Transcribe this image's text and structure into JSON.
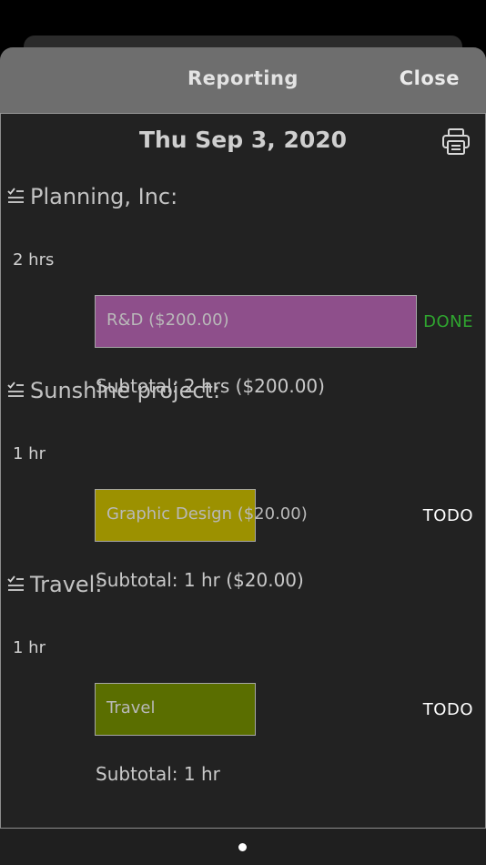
{
  "header": {
    "title": "Reporting",
    "close_label": "Close"
  },
  "date_title": "Thu Sep 3, 2020",
  "icons": {
    "print": "printer-icon",
    "task_list": "task-list-icon"
  },
  "projects": [
    {
      "name": "Planning, Inc:",
      "tasks": [
        {
          "hours": "2 hrs",
          "label": "R&D ($200.00)",
          "color": "#8e4f8b",
          "fill_fraction": 1.0,
          "status": "DONE",
          "status_color": "#2fa52f"
        }
      ],
      "subtotal": "Subtotal: 2 hrs ($200.00)"
    },
    {
      "name": "Sunshine project:",
      "tasks": [
        {
          "hours": "1 hr",
          "label": "Graphic Design ($20.00)",
          "color": "#9c9100",
          "fill_fraction": 0.5,
          "status": "TODO",
          "status_color": "#ffffff"
        }
      ],
      "subtotal": "Subtotal: 1 hr ($20.00)"
    },
    {
      "name": "Travel:",
      "tasks": [
        {
          "hours": "1 hr",
          "label": "Travel",
          "color": "#5a6e00",
          "fill_fraction": 0.5,
          "status": "TODO",
          "status_color": "#ffffff"
        }
      ],
      "subtotal": "Subtotal: 1 hr"
    }
  ],
  "pager": {
    "pages": 1,
    "current": 1
  }
}
